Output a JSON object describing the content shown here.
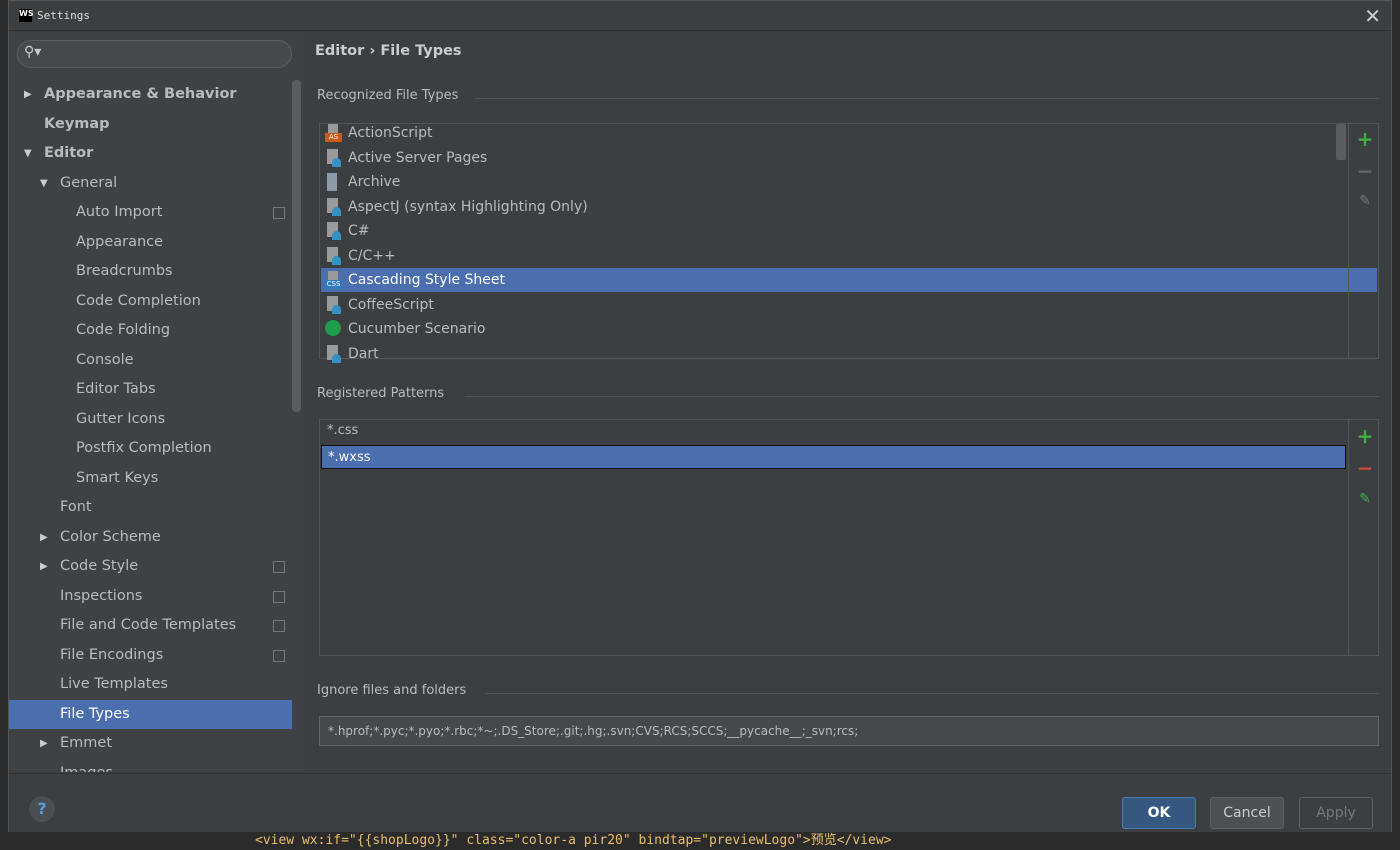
{
  "window": {
    "title": "Settings",
    "logo": "WS",
    "close_icon": "close-icon"
  },
  "search": {
    "placeholder": "",
    "icon": "search-icon"
  },
  "tree": [
    {
      "label": "Appearance & Behavior",
      "level": 0,
      "bold": true,
      "arrow": "right"
    },
    {
      "label": "Keymap",
      "level": 0,
      "bold": true
    },
    {
      "label": "Editor",
      "level": 0,
      "bold": true,
      "arrow": "down"
    },
    {
      "label": "General",
      "level": 1,
      "arrow": "down"
    },
    {
      "label": "Auto Import",
      "level": 2,
      "copy": true
    },
    {
      "label": "Appearance",
      "level": 2
    },
    {
      "label": "Breadcrumbs",
      "level": 2
    },
    {
      "label": "Code Completion",
      "level": 2
    },
    {
      "label": "Code Folding",
      "level": 2
    },
    {
      "label": "Console",
      "level": 2
    },
    {
      "label": "Editor Tabs",
      "level": 2
    },
    {
      "label": "Gutter Icons",
      "level": 2
    },
    {
      "label": "Postfix Completion",
      "level": 2
    },
    {
      "label": "Smart Keys",
      "level": 2
    },
    {
      "label": "Font",
      "level": 1
    },
    {
      "label": "Color Scheme",
      "level": 1,
      "arrow": "right"
    },
    {
      "label": "Code Style",
      "level": 1,
      "arrow": "right",
      "copy": true
    },
    {
      "label": "Inspections",
      "level": 1,
      "copy": true
    },
    {
      "label": "File and Code Templates",
      "level": 1,
      "copy": true
    },
    {
      "label": "File Encodings",
      "level": 1,
      "copy": true
    },
    {
      "label": "Live Templates",
      "level": 1
    },
    {
      "label": "File Types",
      "level": 1,
      "selected": true
    },
    {
      "label": "Emmet",
      "level": 1,
      "arrow": "right"
    },
    {
      "label": "Images",
      "level": 1
    }
  ],
  "main": {
    "breadcrumb": "Editor › File Types",
    "recognized_label": "Recognized File Types",
    "file_types": [
      {
        "label": "ActionScript",
        "icon": "actionscript-icon",
        "badge": "AS",
        "color": "#c75c1e"
      },
      {
        "label": "Active Server Pages",
        "icon": "file-type-icon"
      },
      {
        "label": "Archive",
        "icon": "archive-icon"
      },
      {
        "label": "AspectJ (syntax Highlighting Only)",
        "icon": "file-type-icon"
      },
      {
        "label": "C#",
        "icon": "file-type-icon"
      },
      {
        "label": "C/C++",
        "icon": "file-type-icon"
      },
      {
        "label": "Cascading Style Sheet",
        "icon": "css-icon",
        "badge": "CSS",
        "color": "#2d7bbf",
        "selected": true
      },
      {
        "label": "CoffeeScript",
        "icon": "coffeescript-icon"
      },
      {
        "label": "Cucumber Scenario",
        "icon": "cucumber-icon"
      },
      {
        "label": "Dart",
        "icon": "file-type-icon"
      }
    ],
    "patterns_label": "Registered Patterns",
    "patterns": [
      {
        "label": "*.css"
      },
      {
        "label": "*.wxss",
        "selected": true
      }
    ],
    "ignore_label": "Ignore files and folders",
    "ignore_value": "*.hprof;*.pyc;*.pyo;*.rbc;*~;.DS_Store;.git;.hg;.svn;CVS;RCS;SCCS;__pycache__;_svn;rcs;"
  },
  "footer": {
    "help": "?",
    "ok": "OK",
    "cancel": "Cancel",
    "apply": "Apply"
  },
  "background_code": "<view wx:if=\"{{shopLogo}}\" class=\"color-a pir20\" bindtap=\"previewLogo\">预览</view>",
  "colors": {
    "selection": "#4b6eaf",
    "add": "#3fad46",
    "remove": "#c74a3a",
    "accent_ok": "#365880"
  }
}
